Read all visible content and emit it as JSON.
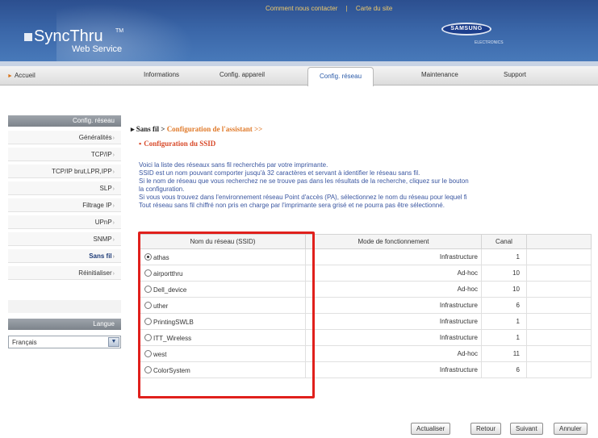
{
  "header": {
    "logo_text": "SyncThru",
    "logo_tm": "TM",
    "logo_sub": "Web Service",
    "links": [
      "Comment nous contacter",
      "|",
      "Carte du site"
    ],
    "brand": "SAMSUNG",
    "brand_sub": "ELECTRONICS"
  },
  "nav": {
    "home": "Accueil",
    "tabs": [
      "Informations",
      "Config. appareil",
      "Config. réseau",
      "Maintenance",
      "Support"
    ],
    "active_tab": "Config. réseau"
  },
  "sidebar": {
    "title": "Config. réseau",
    "items": [
      "Généralités",
      "TCP/IP",
      "TCP/IP brut,LPR,IPP",
      "SLP",
      "Filtrage IP",
      "UPnP",
      "SNMP",
      "Sans fil",
      "Réinitialiser"
    ],
    "active_item": "Sans fil",
    "language_title": "Langue",
    "language_value": "Français"
  },
  "main": {
    "breadcrumb_root": "Sans fil",
    "breadcrumb_current": "Configuration de l'assistant >>",
    "section_title": "Configuration du SSID",
    "paragraphs": [
      "Voici la liste des réseaux sans fil recherchés par votre imprimante.",
      "SSID est un nom pouvant comporter jusqu'à 32 caractères et servant à identifier le réseau sans fil.",
      "Si le nom de réseau que vous recherchez ne se trouve pas dans les résultats de la recherche, cliquez sur le bouton",
      "la configuration.",
      "Si vous vous trouvez dans l'environnement réseau Point d'accès (PA), sélectionnez le nom du réseau pour lequel fi",
      "Tout réseau sans fil chiffré non pris en charge par l'imprimante sera grisé et ne pourra pas être sélectionné."
    ],
    "table": {
      "headers": [
        "Nom du réseau (SSID)",
        "Mode de fonctionnement",
        "Canal"
      ],
      "rows": [
        {
          "ssid": "athas",
          "mode": "Infrastructure",
          "channel": "1",
          "selected": true
        },
        {
          "ssid": "airportthru",
          "mode": "Ad-hoc",
          "channel": "10",
          "selected": false
        },
        {
          "ssid": "Dell_device",
          "mode": "Ad-hoc",
          "channel": "10",
          "selected": false
        },
        {
          "ssid": "uther",
          "mode": "Infrastructure",
          "channel": "6",
          "selected": false
        },
        {
          "ssid": "PrintingSWLB",
          "mode": "Infrastructure",
          "channel": "1",
          "selected": false
        },
        {
          "ssid": "ITT_Wireless",
          "mode": "Infrastructure",
          "channel": "1",
          "selected": false
        },
        {
          "ssid": "west",
          "mode": "Ad-hoc",
          "channel": "11",
          "selected": false
        },
        {
          "ssid": "ColorSystem",
          "mode": "Infrastructure",
          "channel": "6",
          "selected": false
        }
      ]
    },
    "buttons": [
      "Actualiser",
      "Retour",
      "Suivant",
      "Annuler"
    ]
  },
  "colors": {
    "header_blue": "#3a66a8",
    "accent_orange": "#e07a2a",
    "title_red": "#d84a2a",
    "text_blue": "#3a56a0",
    "highlight_red": "#e0201c"
  }
}
